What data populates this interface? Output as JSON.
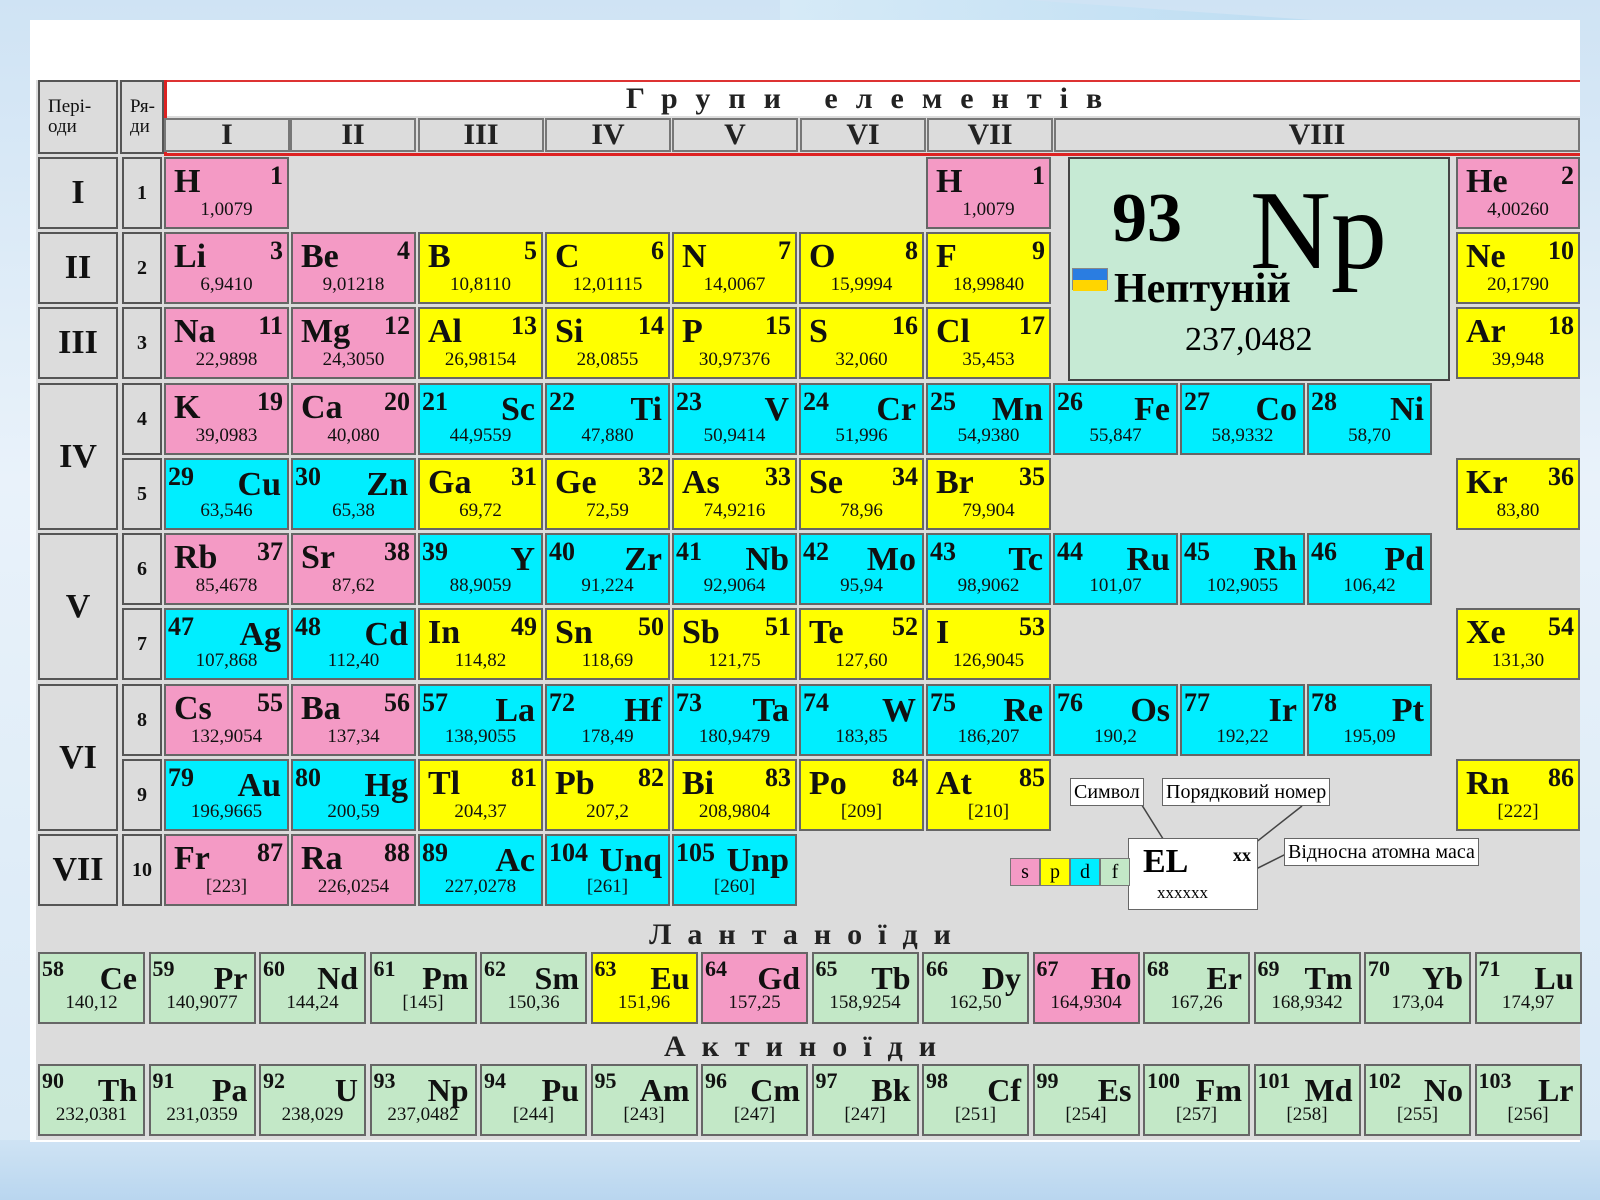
{
  "headers": {
    "periods": "Пері-оди",
    "rows": "Ря-ди",
    "groups_title": "Групи елементів",
    "groups": [
      "I",
      "II",
      "III",
      "IV",
      "V",
      "VI",
      "VII",
      "VIII"
    ]
  },
  "periods": [
    "I",
    "II",
    "III",
    "IV",
    "V",
    "VI",
    "VII"
  ],
  "rows": [
    "1",
    "2",
    "3",
    "4",
    "5",
    "6",
    "7",
    "8",
    "9",
    "10"
  ],
  "elements": [
    {
      "sym": "H",
      "num": "1",
      "mass": "1,0079",
      "type": "s",
      "layout": "nl",
      "col": 0,
      "row": 0
    },
    {
      "sym": "H",
      "num": "1",
      "mass": "1,0079",
      "type": "s",
      "layout": "nl",
      "col": 6,
      "row": 0
    },
    {
      "sym": "He",
      "num": "2",
      "mass": "4,00260",
      "type": "s",
      "layout": "nl",
      "col": 10,
      "row": 0
    },
    {
      "sym": "Li",
      "num": "3",
      "mass": "6,9410",
      "type": "s",
      "layout": "nl",
      "col": 0,
      "row": 1
    },
    {
      "sym": "Be",
      "num": "4",
      "mass": "9,01218",
      "type": "s",
      "layout": "nl",
      "col": 1,
      "row": 1
    },
    {
      "sym": "B",
      "num": "5",
      "mass": "10,8110",
      "type": "p",
      "layout": "nl",
      "col": 2,
      "row": 1
    },
    {
      "sym": "C",
      "num": "6",
      "mass": "12,01115",
      "type": "p",
      "layout": "nl",
      "col": 3,
      "row": 1
    },
    {
      "sym": "N",
      "num": "7",
      "mass": "14,0067",
      "type": "p",
      "layout": "nl",
      "col": 4,
      "row": 1
    },
    {
      "sym": "O",
      "num": "8",
      "mass": "15,9994",
      "type": "p",
      "layout": "nl",
      "col": 5,
      "row": 1
    },
    {
      "sym": "F",
      "num": "9",
      "mass": "18,99840",
      "type": "p",
      "layout": "nl",
      "col": 6,
      "row": 1
    },
    {
      "sym": "Ne",
      "num": "10",
      "mass": "20,1790",
      "type": "p",
      "layout": "nl",
      "col": 10,
      "row": 1
    },
    {
      "sym": "Na",
      "num": "11",
      "mass": "22,9898",
      "type": "s",
      "layout": "nl",
      "col": 0,
      "row": 2
    },
    {
      "sym": "Mg",
      "num": "12",
      "mass": "24,3050",
      "type": "s",
      "layout": "nl",
      "col": 1,
      "row": 2
    },
    {
      "sym": "Al",
      "num": "13",
      "mass": "26,98154",
      "type": "p",
      "layout": "nl",
      "col": 2,
      "row": 2
    },
    {
      "sym": "Si",
      "num": "14",
      "mass": "28,0855",
      "type": "p",
      "layout": "nl",
      "col": 3,
      "row": 2
    },
    {
      "sym": "P",
      "num": "15",
      "mass": "30,97376",
      "type": "p",
      "layout": "nl",
      "col": 4,
      "row": 2
    },
    {
      "sym": "S",
      "num": "16",
      "mass": "32,060",
      "type": "p",
      "layout": "nl",
      "col": 5,
      "row": 2
    },
    {
      "sym": "Cl",
      "num": "17",
      "mass": "35,453",
      "type": "p",
      "layout": "nl",
      "col": 6,
      "row": 2
    },
    {
      "sym": "Ar",
      "num": "18",
      "mass": "39,948",
      "type": "p",
      "layout": "nl",
      "col": 10,
      "row": 2
    },
    {
      "sym": "K",
      "num": "19",
      "mass": "39,0983",
      "type": "s",
      "layout": "nl",
      "col": 0,
      "row": 3
    },
    {
      "sym": "Ca",
      "num": "20",
      "mass": "40,080",
      "type": "s",
      "layout": "nl",
      "col": 1,
      "row": 3
    },
    {
      "sym": "Sc",
      "num": "21",
      "mass": "44,9559",
      "type": "d",
      "layout": "nr",
      "col": 2,
      "row": 3
    },
    {
      "sym": "Ti",
      "num": "22",
      "mass": "47,880",
      "type": "d",
      "layout": "nr",
      "col": 3,
      "row": 3
    },
    {
      "sym": "V",
      "num": "23",
      "mass": "50,9414",
      "type": "d",
      "layout": "nr",
      "col": 4,
      "row": 3
    },
    {
      "sym": "Cr",
      "num": "24",
      "mass": "51,996",
      "type": "d",
      "layout": "nr",
      "col": 5,
      "row": 3
    },
    {
      "sym": "Mn",
      "num": "25",
      "mass": "54,9380",
      "type": "d",
      "layout": "nr",
      "col": 6,
      "row": 3
    },
    {
      "sym": "Fe",
      "num": "26",
      "mass": "55,847",
      "type": "d",
      "layout": "nr",
      "col": 7,
      "row": 3
    },
    {
      "sym": "Co",
      "num": "27",
      "mass": "58,9332",
      "type": "d",
      "layout": "nr",
      "col": 8,
      "row": 3
    },
    {
      "sym": "Ni",
      "num": "28",
      "mass": "58,70",
      "type": "d",
      "layout": "nr",
      "col": 9,
      "row": 3
    },
    {
      "sym": "Cu",
      "num": "29",
      "mass": "63,546",
      "type": "d",
      "layout": "nr",
      "col": 0,
      "row": 4
    },
    {
      "sym": "Zn",
      "num": "30",
      "mass": "65,38",
      "type": "d",
      "layout": "nr",
      "col": 1,
      "row": 4
    },
    {
      "sym": "Ga",
      "num": "31",
      "mass": "69,72",
      "type": "p",
      "layout": "nl",
      "col": 2,
      "row": 4
    },
    {
      "sym": "Ge",
      "num": "32",
      "mass": "72,59",
      "type": "p",
      "layout": "nl",
      "col": 3,
      "row": 4
    },
    {
      "sym": "As",
      "num": "33",
      "mass": "74,9216",
      "type": "p",
      "layout": "nl",
      "col": 4,
      "row": 4
    },
    {
      "sym": "Se",
      "num": "34",
      "mass": "78,96",
      "type": "p",
      "layout": "nl",
      "col": 5,
      "row": 4
    },
    {
      "sym": "Br",
      "num": "35",
      "mass": "79,904",
      "type": "p",
      "layout": "nl",
      "col": 6,
      "row": 4
    },
    {
      "sym": "Kr",
      "num": "36",
      "mass": "83,80",
      "type": "p",
      "layout": "nl",
      "col": 10,
      "row": 4
    },
    {
      "sym": "Rb",
      "num": "37",
      "mass": "85,4678",
      "type": "s",
      "layout": "nl",
      "col": 0,
      "row": 5
    },
    {
      "sym": "Sr",
      "num": "38",
      "mass": "87,62",
      "type": "s",
      "layout": "nl",
      "col": 1,
      "row": 5
    },
    {
      "sym": "Y",
      "num": "39",
      "mass": "88,9059",
      "type": "d",
      "layout": "nr",
      "col": 2,
      "row": 5
    },
    {
      "sym": "Zr",
      "num": "40",
      "mass": "91,224",
      "type": "d",
      "layout": "nr",
      "col": 3,
      "row": 5
    },
    {
      "sym": "Nb",
      "num": "41",
      "mass": "92,9064",
      "type": "d",
      "layout": "nr",
      "col": 4,
      "row": 5
    },
    {
      "sym": "Mo",
      "num": "42",
      "mass": "95,94",
      "type": "d",
      "layout": "nr",
      "col": 5,
      "row": 5
    },
    {
      "sym": "Tc",
      "num": "43",
      "mass": "98,9062",
      "type": "d",
      "layout": "nr",
      "col": 6,
      "row": 5
    },
    {
      "sym": "Ru",
      "num": "44",
      "mass": "101,07",
      "type": "d",
      "layout": "nr",
      "col": 7,
      "row": 5
    },
    {
      "sym": "Rh",
      "num": "45",
      "mass": "102,9055",
      "type": "d",
      "layout": "nr",
      "col": 8,
      "row": 5
    },
    {
      "sym": "Pd",
      "num": "46",
      "mass": "106,42",
      "type": "d",
      "layout": "nr",
      "col": 9,
      "row": 5
    },
    {
      "sym": "Ag",
      "num": "47",
      "mass": "107,868",
      "type": "d",
      "layout": "nr",
      "col": 0,
      "row": 6
    },
    {
      "sym": "Cd",
      "num": "48",
      "mass": "112,40",
      "type": "d",
      "layout": "nr",
      "col": 1,
      "row": 6
    },
    {
      "sym": "In",
      "num": "49",
      "mass": "114,82",
      "type": "p",
      "layout": "nl",
      "col": 2,
      "row": 6
    },
    {
      "sym": "Sn",
      "num": "50",
      "mass": "118,69",
      "type": "p",
      "layout": "nl",
      "col": 3,
      "row": 6
    },
    {
      "sym": "Sb",
      "num": "51",
      "mass": "121,75",
      "type": "p",
      "layout": "nl",
      "col": 4,
      "row": 6
    },
    {
      "sym": "Te",
      "num": "52",
      "mass": "127,60",
      "type": "p",
      "layout": "nl",
      "col": 5,
      "row": 6
    },
    {
      "sym": "I",
      "num": "53",
      "mass": "126,9045",
      "type": "p",
      "layout": "nl",
      "col": 6,
      "row": 6
    },
    {
      "sym": "Xe",
      "num": "54",
      "mass": "131,30",
      "type": "p",
      "layout": "nl",
      "col": 10,
      "row": 6
    },
    {
      "sym": "Cs",
      "num": "55",
      "mass": "132,9054",
      "type": "s",
      "layout": "nl",
      "col": 0,
      "row": 7
    },
    {
      "sym": "Ba",
      "num": "56",
      "mass": "137,34",
      "type": "s",
      "layout": "nl",
      "col": 1,
      "row": 7
    },
    {
      "sym": "La",
      "num": "57",
      "mass": "138,9055",
      "type": "d",
      "layout": "nr",
      "col": 2,
      "row": 7
    },
    {
      "sym": "Hf",
      "num": "72",
      "mass": "178,49",
      "type": "d",
      "layout": "nr",
      "col": 3,
      "row": 7
    },
    {
      "sym": "Ta",
      "num": "73",
      "mass": "180,9479",
      "type": "d",
      "layout": "nr",
      "col": 4,
      "row": 7
    },
    {
      "sym": "W",
      "num": "74",
      "mass": "183,85",
      "type": "d",
      "layout": "nr",
      "col": 5,
      "row": 7
    },
    {
      "sym": "Re",
      "num": "75",
      "mass": "186,207",
      "type": "d",
      "layout": "nr",
      "col": 6,
      "row": 7
    },
    {
      "sym": "Os",
      "num": "76",
      "mass": "190,2",
      "type": "d",
      "layout": "nr",
      "col": 7,
      "row": 7
    },
    {
      "sym": "Ir",
      "num": "77",
      "mass": "192,22",
      "type": "d",
      "layout": "nr",
      "col": 8,
      "row": 7
    },
    {
      "sym": "Pt",
      "num": "78",
      "mass": "195,09",
      "type": "d",
      "layout": "nr",
      "col": 9,
      "row": 7
    },
    {
      "sym": "Au",
      "num": "79",
      "mass": "196,9665",
      "type": "d",
      "layout": "nr",
      "col": 0,
      "row": 8
    },
    {
      "sym": "Hg",
      "num": "80",
      "mass": "200,59",
      "type": "d",
      "layout": "nr",
      "col": 1,
      "row": 8
    },
    {
      "sym": "Tl",
      "num": "81",
      "mass": "204,37",
      "type": "p",
      "layout": "nl",
      "col": 2,
      "row": 8
    },
    {
      "sym": "Pb",
      "num": "82",
      "mass": "207,2",
      "type": "p",
      "layout": "nl",
      "col": 3,
      "row": 8
    },
    {
      "sym": "Bi",
      "num": "83",
      "mass": "208,9804",
      "type": "p",
      "layout": "nl",
      "col": 4,
      "row": 8
    },
    {
      "sym": "Po",
      "num": "84",
      "mass": "[209]",
      "type": "p",
      "layout": "nl",
      "col": 5,
      "row": 8
    },
    {
      "sym": "At",
      "num": "85",
      "mass": "[210]",
      "type": "p",
      "layout": "nl",
      "col": 6,
      "row": 8
    },
    {
      "sym": "Rn",
      "num": "86",
      "mass": "[222]",
      "type": "p",
      "layout": "nl",
      "col": 10,
      "row": 8
    },
    {
      "sym": "Fr",
      "num": "87",
      "mass": "[223]",
      "type": "s",
      "layout": "nl",
      "col": 0,
      "row": 9
    },
    {
      "sym": "Ra",
      "num": "88",
      "mass": "226,0254",
      "type": "s",
      "layout": "nl",
      "col": 1,
      "row": 9
    },
    {
      "sym": "Ac",
      "num": "89",
      "mass": "227,0278",
      "type": "d",
      "layout": "nr",
      "col": 2,
      "row": 9
    },
    {
      "sym": "Unq",
      "num": "104",
      "mass": "[261]",
      "type": "d",
      "layout": "nr",
      "col": 3,
      "row": 9
    },
    {
      "sym": "Unp",
      "num": "105",
      "mass": "[260]",
      "type": "d",
      "layout": "nr",
      "col": 4,
      "row": 9
    }
  ],
  "featured": {
    "number": "93",
    "symbol": "Np",
    "name": "Нептуній",
    "mass": "237,0482"
  },
  "lanthanoids_title": "Лантаноїди",
  "actinoids_title": "Актиноїди",
  "lanthanoids": [
    {
      "num": "58",
      "sym": "Ce",
      "mass": "140,12",
      "type": "f"
    },
    {
      "num": "59",
      "sym": "Pr",
      "mass": "140,9077",
      "type": "f"
    },
    {
      "num": "60",
      "sym": "Nd",
      "mass": "144,24",
      "type": "f"
    },
    {
      "num": "61",
      "sym": "Pm",
      "mass": "[145]",
      "type": "f"
    },
    {
      "num": "62",
      "sym": "Sm",
      "mass": "150,36",
      "type": "f"
    },
    {
      "num": "63",
      "sym": "Eu",
      "mass": "151,96",
      "type": "p"
    },
    {
      "num": "64",
      "sym": "Gd",
      "mass": "157,25",
      "type": "s"
    },
    {
      "num": "65",
      "sym": "Tb",
      "mass": "158,9254",
      "type": "f"
    },
    {
      "num": "66",
      "sym": "Dy",
      "mass": "162,50",
      "type": "f"
    },
    {
      "num": "67",
      "sym": "Ho",
      "mass": "164,9304",
      "type": "s"
    },
    {
      "num": "68",
      "sym": "Er",
      "mass": "167,26",
      "type": "f"
    },
    {
      "num": "69",
      "sym": "Tm",
      "mass": "168,9342",
      "type": "f"
    },
    {
      "num": "70",
      "sym": "Yb",
      "mass": "173,04",
      "type": "f"
    },
    {
      "num": "71",
      "sym": "Lu",
      "mass": "174,97",
      "type": "f"
    }
  ],
  "actinoids": [
    {
      "num": "90",
      "sym": "Th",
      "mass": "232,0381",
      "type": "f"
    },
    {
      "num": "91",
      "sym": "Pa",
      "mass": "231,0359",
      "type": "f"
    },
    {
      "num": "92",
      "sym": "U",
      "mass": "238,029",
      "type": "f"
    },
    {
      "num": "93",
      "sym": "Np",
      "mass": "237,0482",
      "type": "f"
    },
    {
      "num": "94",
      "sym": "Pu",
      "mass": "[244]",
      "type": "f"
    },
    {
      "num": "95",
      "sym": "Am",
      "mass": "[243]",
      "type": "f"
    },
    {
      "num": "96",
      "sym": "Cm",
      "mass": "[247]",
      "type": "f"
    },
    {
      "num": "97",
      "sym": "Bk",
      "mass": "[247]",
      "type": "f"
    },
    {
      "num": "98",
      "sym": "Cf",
      "mass": "[251]",
      "type": "f"
    },
    {
      "num": "99",
      "sym": "Es",
      "mass": "[254]",
      "type": "f"
    },
    {
      "num": "100",
      "sym": "Fm",
      "mass": "[257]",
      "type": "f"
    },
    {
      "num": "101",
      "sym": "Md",
      "mass": "[258]",
      "type": "f"
    },
    {
      "num": "102",
      "sym": "No",
      "mass": "[255]",
      "type": "f"
    },
    {
      "num": "103",
      "sym": "Lr",
      "mass": "[256]",
      "type": "f"
    }
  ],
  "legend": {
    "symbol_label": "Символ",
    "number_label": "Порядковий номер",
    "mass_label": "Відносна атомна маса",
    "el": "EL",
    "xx": "xx",
    "xxxxxx": "xxxxxx",
    "blocks": [
      "s",
      "p",
      "d",
      "f"
    ]
  },
  "colors": {
    "s": "#f49ac5",
    "p": "#ffff00",
    "d": "#00eeff",
    "f": "#c3e8c7"
  }
}
